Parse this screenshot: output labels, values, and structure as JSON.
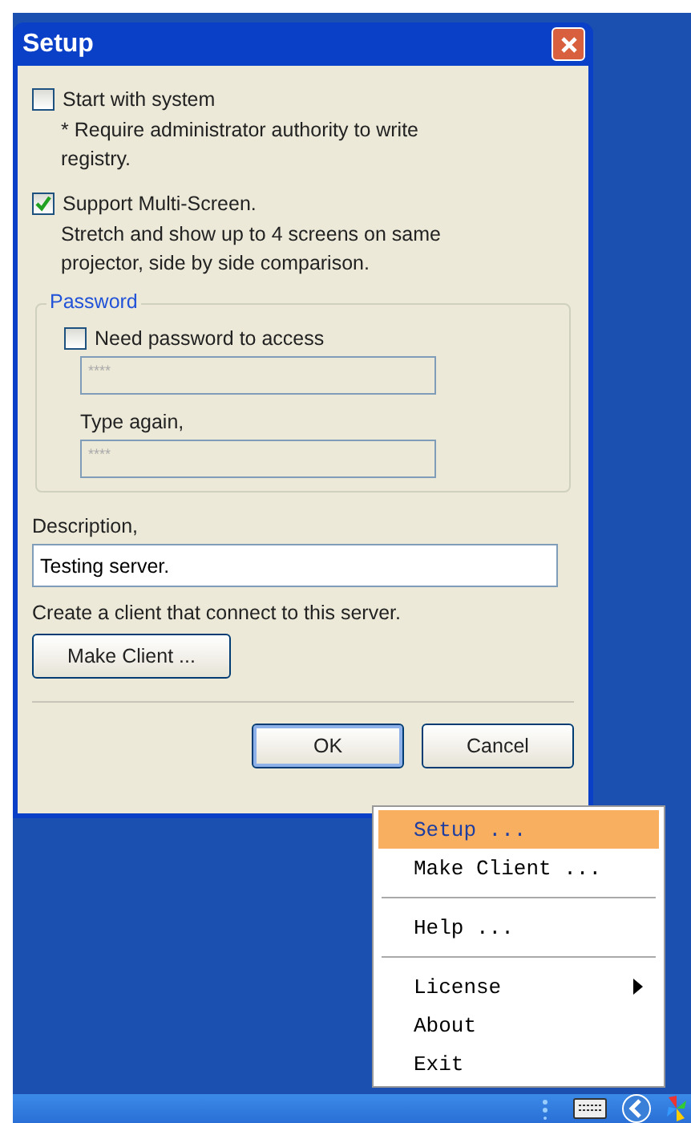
{
  "dialog": {
    "title": "Setup",
    "start_with_system": {
      "label": "Start with system",
      "checked": false,
      "note": "* Require administrator authority to write registry."
    },
    "multi_screen": {
      "label": "Support Multi-Screen.",
      "checked": true,
      "note": "Stretch and show up to 4 screens on same projector, side by side comparison."
    },
    "password": {
      "legend": "Password",
      "need_password": {
        "label": "Need password to access",
        "checked": false
      },
      "password_field": {
        "value": "****",
        "disabled": true
      },
      "retype_label": "Type again,",
      "retype_field": {
        "value": "****",
        "disabled": true
      }
    },
    "description": {
      "label": "Description,",
      "value": "Testing server."
    },
    "client_hint": "Create a client that connect to this server.",
    "make_client_button": "Make Client ...",
    "buttons": [
      {
        "label": "OK",
        "default": true
      },
      {
        "label": "Cancel",
        "default": false
      }
    ]
  },
  "tray_menu": {
    "items": [
      {
        "kind": "item",
        "label": "Setup ...",
        "selected": true,
        "submenu": false
      },
      {
        "kind": "item",
        "label": "Make Client ...",
        "selected": false,
        "submenu": false
      },
      {
        "kind": "separator"
      },
      {
        "kind": "item",
        "label": "Help ...",
        "selected": false,
        "submenu": false
      },
      {
        "kind": "separator"
      },
      {
        "kind": "item",
        "label": "License",
        "selected": false,
        "submenu": true
      },
      {
        "kind": "item",
        "label": "About",
        "selected": false,
        "submenu": false
      },
      {
        "kind": "item",
        "label": "Exit",
        "selected": false,
        "submenu": false
      }
    ]
  }
}
